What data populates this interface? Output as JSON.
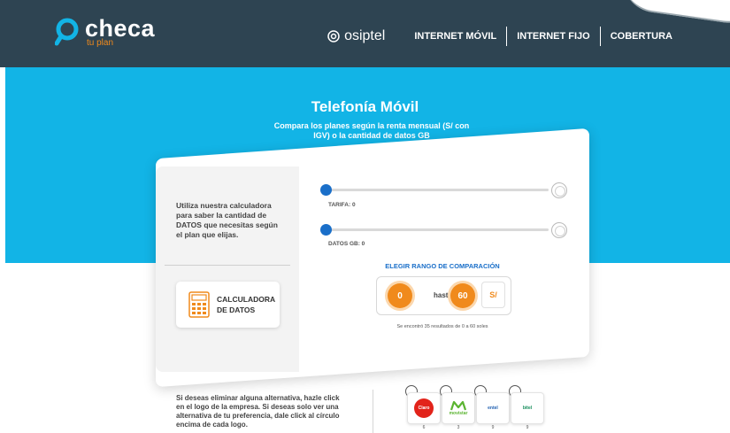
{
  "header": {
    "logo_word": "checa",
    "logo_sub": "tu plan",
    "osiptel_label": "osiptel",
    "nav": [
      {
        "label": "INTERNET MÓVIL"
      },
      {
        "label": "INTERNET FIJO"
      },
      {
        "label": "COBERTURA"
      }
    ]
  },
  "hero": {
    "title": "Telefonía Móvil",
    "subtitle": "Compara los planes según la renta mensual (S/ con IGV) o la cantidad de datos GB"
  },
  "calculator_panel": {
    "intro": "Utiliza nuestra calculadora para saber la cantidad de DATOS que necesitas según el plan que elijas.",
    "button_label": "CALCULADORA DE DATOS"
  },
  "sliders": {
    "tarifa_caption": "TARIFA: 0",
    "tarifa_value": 0,
    "datos_caption": "DATOS GB: 0",
    "datos_value": 0
  },
  "range": {
    "title": "ELEGIR RANGO DE COMPARACIÓN",
    "from": "0",
    "to_word": "hasta",
    "to": "60",
    "currency": "S/",
    "found": "Se encontró 35 resultados de 0 a 60 soles"
  },
  "operators": {
    "instructions": "Si deseas eliminar alguna alternativa, hazle click en el logo de la empresa. Si deseas solo ver una alternativa de tu preferencia, dale click al círculo encima de cada logo.",
    "items": [
      {
        "name": "Claro",
        "count": "6",
        "color": "#e2231a"
      },
      {
        "name": "movistar",
        "count": "3",
        "color": "#5bb431"
      },
      {
        "name": "entel",
        "count": "9",
        "color": "#1f5fb0"
      },
      {
        "name": "bitel",
        "count": "9",
        "color": "#148c5a"
      }
    ]
  },
  "colors": {
    "header_bg": "#2e4452",
    "hero_bg": "#12b4e6",
    "accent_orange": "#f08a1c",
    "slider_blue": "#1a6fc9"
  }
}
